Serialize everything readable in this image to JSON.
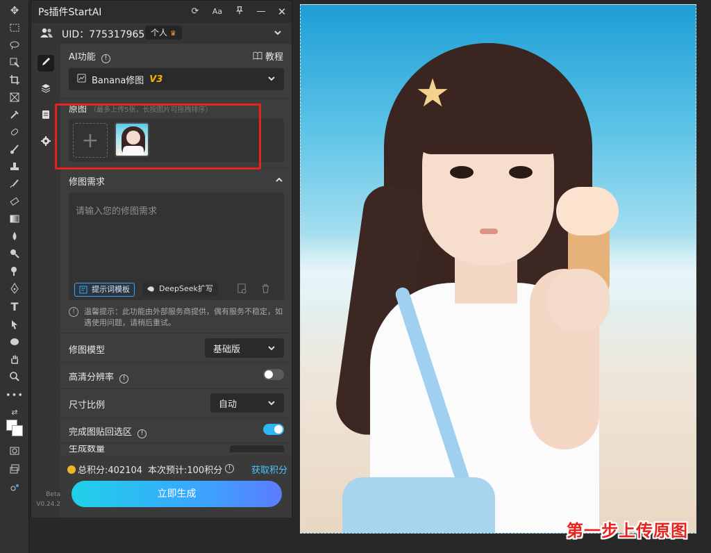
{
  "panel": {
    "title": "Ps插件StartAI",
    "titlebar_buttons": [
      "refresh-icon",
      "font-size-icon",
      "pin-icon",
      "minimize-icon",
      "close-icon"
    ],
    "font_button_label": "Aa"
  },
  "user": {
    "uid_label": "UID：775317965",
    "plan_badge": "个人"
  },
  "ai_function": {
    "label": "AI功能",
    "tutorial_label": "教程",
    "selected_tool": "Banana修图",
    "version_tag": "V3"
  },
  "source": {
    "label": "原图",
    "hint": "（最多上传5张，长按图片可拖拽排序）",
    "thumb_index": "1"
  },
  "prompt": {
    "label": "修图需求",
    "placeholder": "请输入您的修图需求",
    "template_button": "提示词模板",
    "deepseek_button": "DeepSeek扩写"
  },
  "tip": {
    "text": "温馨提示：此功能由外部服务商提供，偶有服务不稳定，如遇使用问题，请稍后重试。"
  },
  "model": {
    "label": "修图模型",
    "value": "基础版"
  },
  "hd": {
    "label": "高清分辨率",
    "enabled": false
  },
  "ratio": {
    "label": "尺寸比例",
    "value": "自动"
  },
  "paste_back": {
    "label": "完成图贴回选区",
    "enabled": true
  },
  "count": {
    "label": "生成数量"
  },
  "footer": {
    "total_points": "总积分:402104",
    "estimate": "本次预计:100积分",
    "get_points": "获取积分",
    "generate_button": "立即生成"
  },
  "version": {
    "stage": "Beta",
    "number": "V0.24.2"
  },
  "canvas": {
    "caption": "第一步上传原图"
  },
  "colors": {
    "accent": "#3aa6ff",
    "highlight": "#e8231f",
    "panel_bg": "#3d3d3d",
    "toggle_on": "#2fb6f5"
  }
}
